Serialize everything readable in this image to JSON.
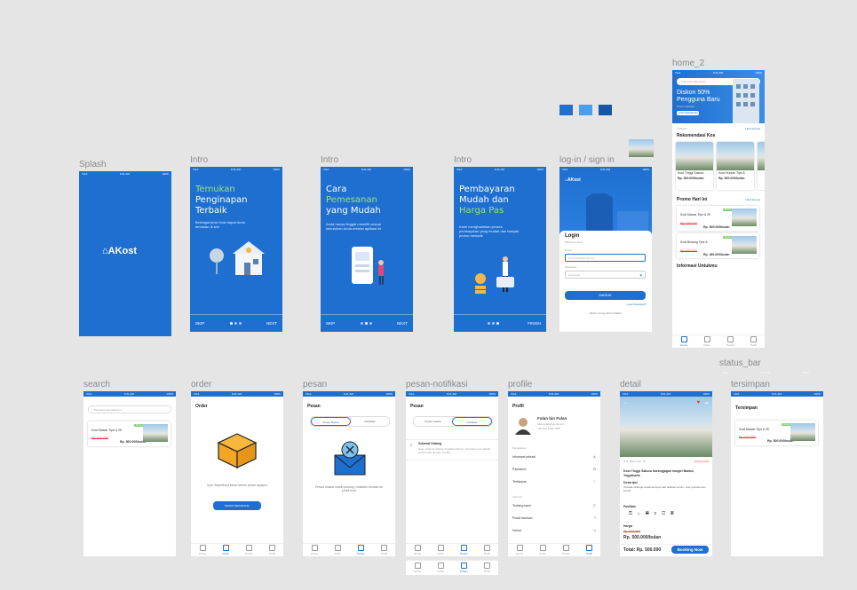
{
  "frames": {
    "splash": {
      "label": "Splash",
      "logo": "AKost"
    },
    "intro1": {
      "label": "Intro",
      "line1": "Temukan",
      "line2": "Penginapan",
      "line3": "Terbaik",
      "desc": "Berbagai jenis Kost dapat Anda temukan di sini",
      "skip": "SKIP",
      "next": "NEXT"
    },
    "intro2": {
      "label": "Intro",
      "line1": "Cara",
      "line2": "Pemesanan",
      "line3": "yang Mudah",
      "desc": "Anda hanya tinggal memilih sesuai kebutuhan Anda melalui aplikasi ini",
      "skip": "SKIP",
      "next": "NEXT"
    },
    "intro3": {
      "label": "Intro",
      "line1": "Pembayaran",
      "line2": "Mudah dan",
      "line3": "Harga Pas",
      "desc": "Kami menghadirkan proses pembayaran yang mudah dan banyak promo menarik",
      "finish": "FINISH"
    },
    "login": {
      "label": "log-in / sign in",
      "logo": "AKost",
      "title": "Login",
      "subtitle": "Masuk ke akun",
      "email_label": "Email",
      "email_placeholder": "email.anda@mail.com",
      "password_label": "Password",
      "password_placeholder": "Password",
      "forgot": "Lupa Password?",
      "button": "MASUK",
      "register": "Belum punya akun? Daftar"
    },
    "home2": {
      "label": "home_2",
      "search_placeholder": "Cari kost atau lokasi",
      "banner_line1": "Diskon 50%",
      "banner_line2": "Pengguna Baru",
      "banner_sub": "Promo Spesial",
      "banner_btn": "LIHAT SEKARANG",
      "location": "Bantul",
      "see_all": "Lihat Semua",
      "reco_title": "Rekomendasi Kos",
      "promo_title": "Promo Hari Ini",
      "promo_all": "Lihat Semua",
      "info_title": "Informasi Untukmu",
      "reco": [
        {
          "name": "Kost Tinggi Sakura",
          "price": "Rp. 500.000/bulan"
        },
        {
          "name": "Kost Hunian Tipe A",
          "price": "Rp. 600.000/bulan"
        }
      ],
      "promos": [
        {
          "name": "Kost Mawar Tipe A 25",
          "old": "Rp. 620.000",
          "price": "Rp. 500.000/bulan",
          "tag": "Promo"
        },
        {
          "name": "Kost Bintang Tipe A",
          "old": "Rp. 520.000",
          "price": "Rp. 480.000/bulan",
          "tag": "Promo"
        }
      ]
    },
    "search": {
      "label": "search",
      "placeholder": "Temukan kost pilihanmu",
      "item_name": "Kost Mawar Tipe A 25",
      "item_old": "Rp. 620.000",
      "item_price": "Rp. 500.000/bulan",
      "tag": "Promo"
    },
    "order": {
      "label": "order",
      "title": "Order",
      "empty": "Ups! Sepertinya kamu belum pesan apapun",
      "button": "PESAN SEKARANG"
    },
    "pesan": {
      "label": "pesan",
      "title": "Pesan",
      "tab1": "Pesan Masuk",
      "tab2": "Notifikasi",
      "empty": "Pesan masuk masih kosong, mulailah obrolan ke pihak kost"
    },
    "pesan_notif": {
      "label": "pesan-notifikasi",
      "title": "Pesan",
      "tab1": "Pesan masuk",
      "tab2": "Notifikasi",
      "notif_title": "Selamat Datang",
      "notif_body": "Halo, selamat datang di aplikasi AKost. Temukan kost terbaik untuk Anda dengan mudah."
    },
    "profile": {
      "label": "profile",
      "title": "Profil",
      "name": "Fulan bin Fulan",
      "email": "fulan.fulan@gmail.com",
      "phone": "+62 812 3456 7890",
      "section1": "Pengaturan",
      "items1": [
        "Informasi pribadi",
        "Password",
        "Tersimpan"
      ],
      "section2": "Lainnya",
      "items2": [
        "Tentang kami",
        "Pusat bantuan",
        "Keluar"
      ]
    },
    "detail": {
      "label": "detail",
      "location": "Jl. Bantul No. 25",
      "tag": "Promo Kost",
      "name": "Kost Tinggi Sakura Karangjagan Imogiri Bantul, Yogyakarta",
      "desc_title": "Deskripsi",
      "desc": "Terletak strategis dekat kampus dan fasilitas umum, kost nyaman dan bersih.",
      "fac_title": "Fasilitas",
      "price_title": "Harga",
      "old": "Rp. 620.000",
      "price": "Rp. 500.000/bulan",
      "total": "Total: Rp. 500.000",
      "button": "Booking Now"
    },
    "status_bar": {
      "label": "status_bar"
    },
    "tersimpan": {
      "label": "tersimpan",
      "title": "Tersimpan",
      "item_name": "Kost Mawar Tipe A 25",
      "item_old": "Rp. 620.000",
      "item_price": "Rp. 500.000/bulan",
      "tag": "Promo"
    }
  },
  "nav_items": [
    "Home",
    "Order",
    "Pesan",
    "Profil"
  ],
  "status": {
    "left": "VGA",
    "time": "9:41 AM",
    "right": "100%"
  },
  "colors": {
    "primary": "#1e6fd0",
    "swatch1": "#1e6fd0",
    "swatch2": "#4aa0f0",
    "swatch3": "#1556a8",
    "accent": "#9be37a"
  }
}
